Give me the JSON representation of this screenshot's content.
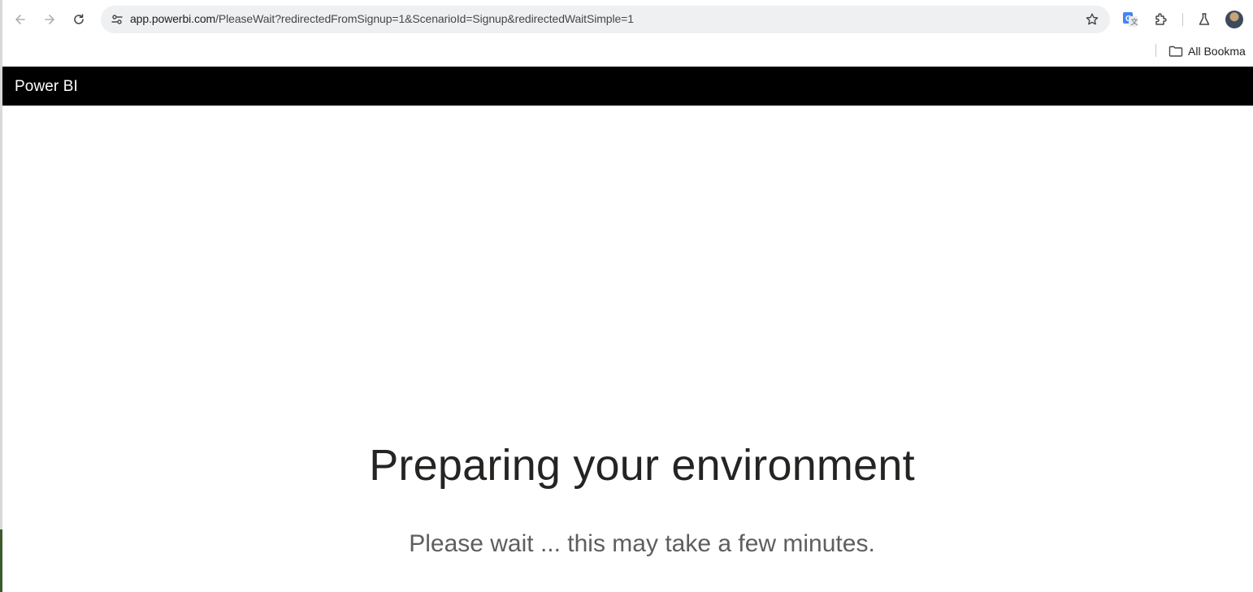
{
  "browser": {
    "url_host": "app.powerbi.com",
    "url_path": "/PleaseWait?redirectedFromSignup=1&ScenarioId=Signup&redirectedWaitSimple=1",
    "bookmarks_label": "All Bookma"
  },
  "icons": {
    "back": "back-arrow-icon",
    "forward": "forward-arrow-icon",
    "reload": "reload-icon",
    "site_info": "tune-icon",
    "bookmark_star": "star-icon",
    "translate": "google-translate-icon",
    "extensions": "puzzle-icon",
    "labs": "flask-icon",
    "bookmarks_folder": "folder-icon"
  },
  "app": {
    "title": "Power BI"
  },
  "main": {
    "heading": "Preparing your environment",
    "subheading": "Please wait ... this may take a few minutes."
  },
  "colors": {
    "header_bg": "#000000",
    "header_text": "#ffffff",
    "heading": "#252423",
    "subheading": "#605e5c"
  }
}
